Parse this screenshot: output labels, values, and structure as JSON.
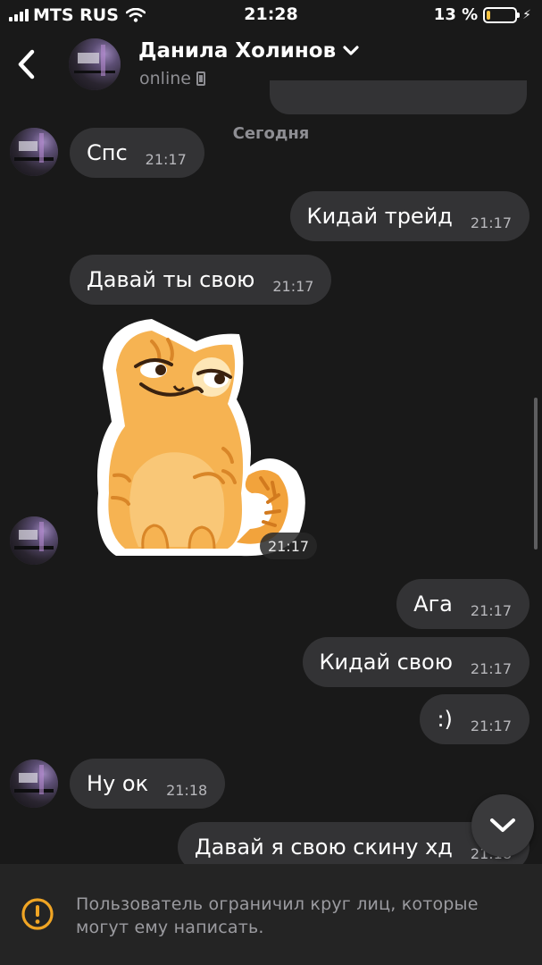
{
  "status_bar": {
    "carrier": "MTS RUS",
    "time": "21:28",
    "battery_percent": "13 %",
    "battery_level": 0.13,
    "battery_color": "#f6c342"
  },
  "header": {
    "back_icon": "chevron-left-icon",
    "contact_name": "Данила Холинов",
    "name_dropdown_icon": "chevron-down-icon",
    "status": "online",
    "status_icon": "mobile-phone-icon"
  },
  "chat": {
    "date_separator": "Сегодня",
    "messages": [
      {
        "direction": "in",
        "text": "Спс",
        "time": "21:17"
      },
      {
        "direction": "out",
        "text": "Кидай трейд",
        "time": "21:17"
      },
      {
        "direction": "in",
        "text": "Давай ты свою",
        "time": "21:17"
      },
      {
        "direction": "in",
        "type": "sticker",
        "sticker": "orange-cat-smirk-sticker",
        "time": "21:17"
      },
      {
        "direction": "out",
        "text": "Ага",
        "time": "21:17"
      },
      {
        "direction": "out",
        "text": "Кидай свою",
        "time": "21:17"
      },
      {
        "direction": "out",
        "text": ":)",
        "time": "21:17"
      },
      {
        "direction": "in",
        "text": "Ну ок",
        "time": "21:18"
      },
      {
        "direction": "out",
        "text": "Давай я свою скину хд",
        "time": "21:18"
      }
    ],
    "bubble_color": "#333335",
    "background_color": "#191919"
  },
  "scroll_down_icon": "chevron-down-icon",
  "restriction": {
    "icon": "warning-icon",
    "icon_color": "#f0a524",
    "text": "Пользователь ограничил круг лиц, которые могут ему написать."
  }
}
